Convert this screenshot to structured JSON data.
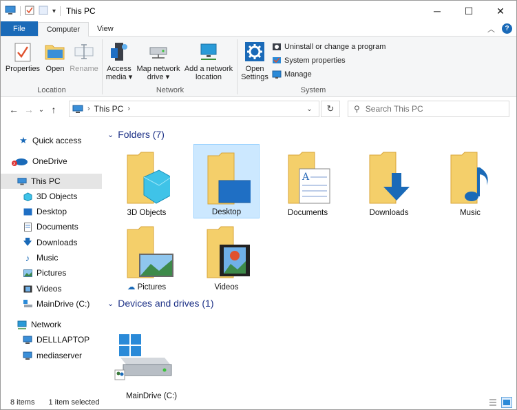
{
  "window": {
    "title": "This PC"
  },
  "ribbon_tabs": [
    {
      "label": "File"
    },
    {
      "label": "Computer"
    },
    {
      "label": "View"
    }
  ],
  "ribbon": {
    "location": {
      "name": "Location",
      "properties": "Properties",
      "open": "Open",
      "rename": "Rename"
    },
    "network": {
      "name": "Network",
      "access_media": [
        "Access",
        "media ▾"
      ],
      "map_drive": [
        "Map network",
        "drive ▾"
      ],
      "add_location": [
        "Add a network",
        "location"
      ]
    },
    "system": {
      "name": "System",
      "open_settings": [
        "Open",
        "Settings"
      ],
      "uninstall": "Uninstall or change a program",
      "system_properties": "System properties",
      "manage": "Manage"
    }
  },
  "address": {
    "path": "This PC",
    "search_placeholder": "Search This PC"
  },
  "nav": {
    "items": [
      {
        "label": "Quick access",
        "icon": "star-icon"
      },
      {
        "label": "OneDrive",
        "icon": "cloud-icon"
      },
      {
        "label": "This PC",
        "icon": "computer-icon"
      },
      {
        "label": "3D Objects",
        "icon": "cube-icon"
      },
      {
        "label": "Desktop",
        "icon": "desktop-icon"
      },
      {
        "label": "Documents",
        "icon": "document-icon"
      },
      {
        "label": "Downloads",
        "icon": "download-icon"
      },
      {
        "label": "Music",
        "icon": "music-icon"
      },
      {
        "label": "Pictures",
        "icon": "picture-icon"
      },
      {
        "label": "Videos",
        "icon": "video-icon"
      },
      {
        "label": "MainDrive (C:)",
        "icon": "drive-icon"
      },
      {
        "label": "Network",
        "icon": "network-icon"
      },
      {
        "label": "DELLLAPTOP",
        "icon": "computer-icon"
      },
      {
        "label": "mediaserver",
        "icon": "computer-icon"
      }
    ]
  },
  "content": {
    "folders_header": "Folders (7)",
    "devices_header": "Devices and drives (1)",
    "folders": [
      {
        "label": "3D Objects"
      },
      {
        "label": "Desktop"
      },
      {
        "label": "Documents"
      },
      {
        "label": "Downloads"
      },
      {
        "label": "Music"
      },
      {
        "label": "Pictures"
      },
      {
        "label": "Videos"
      }
    ],
    "drives": [
      {
        "label": "MainDrive (C:)"
      }
    ]
  },
  "status": {
    "items": "8 items",
    "selected": "1 item selected"
  },
  "colors": {
    "accent": "#1a6ab8",
    "folder": "#f4cf6a",
    "selection": "#cce8ff",
    "group_header": "#1e3287"
  }
}
